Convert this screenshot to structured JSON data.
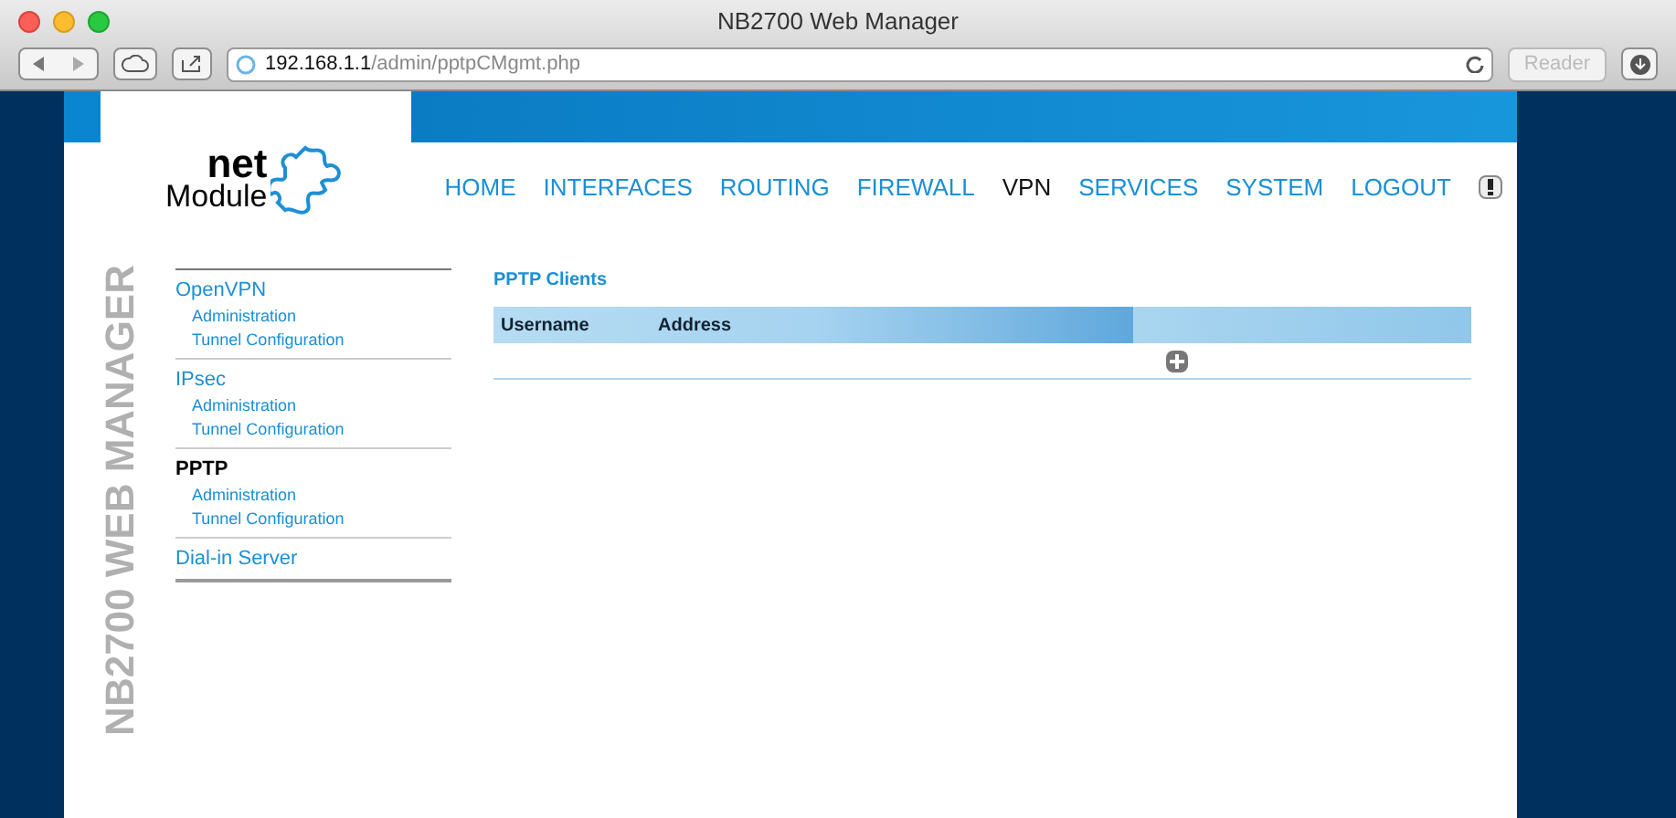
{
  "window": {
    "title": "NB2700 Web Manager"
  },
  "toolbar": {
    "url_host": "192.168.1.1",
    "url_path": "/admin/pptpCMgmt.php",
    "reader": "Reader"
  },
  "logo": {
    "line_1": "net",
    "line_2": "Module"
  },
  "nav": [
    {
      "label": "HOME",
      "selected": false
    },
    {
      "label": "INTERFACES",
      "selected": false
    },
    {
      "label": "ROUTING",
      "selected": false
    },
    {
      "label": "FIREWALL",
      "selected": false
    },
    {
      "label": "VPN",
      "selected": true
    },
    {
      "label": "SERVICES",
      "selected": false
    },
    {
      "label": "SYSTEM",
      "selected": false
    },
    {
      "label": "LOGOUT",
      "selected": false
    }
  ],
  "side_title": "NB2700 WEB MANAGER",
  "sidebar": [
    {
      "label": "OpenVPN",
      "selected": false,
      "children": [
        {
          "label": "Administration"
        },
        {
          "label": "Tunnel Configuration"
        }
      ]
    },
    {
      "label": "IPsec",
      "selected": false,
      "children": [
        {
          "label": "Administration"
        },
        {
          "label": "Tunnel Configuration"
        }
      ]
    },
    {
      "label": "PPTP",
      "selected": true,
      "children": [
        {
          "label": "Administration"
        },
        {
          "label": "Tunnel Configuration"
        }
      ]
    },
    {
      "label": "Dial-in Server",
      "selected": false
    }
  ],
  "content": {
    "title": "PPTP Clients",
    "columns": [
      "Username",
      "Address"
    ]
  }
}
